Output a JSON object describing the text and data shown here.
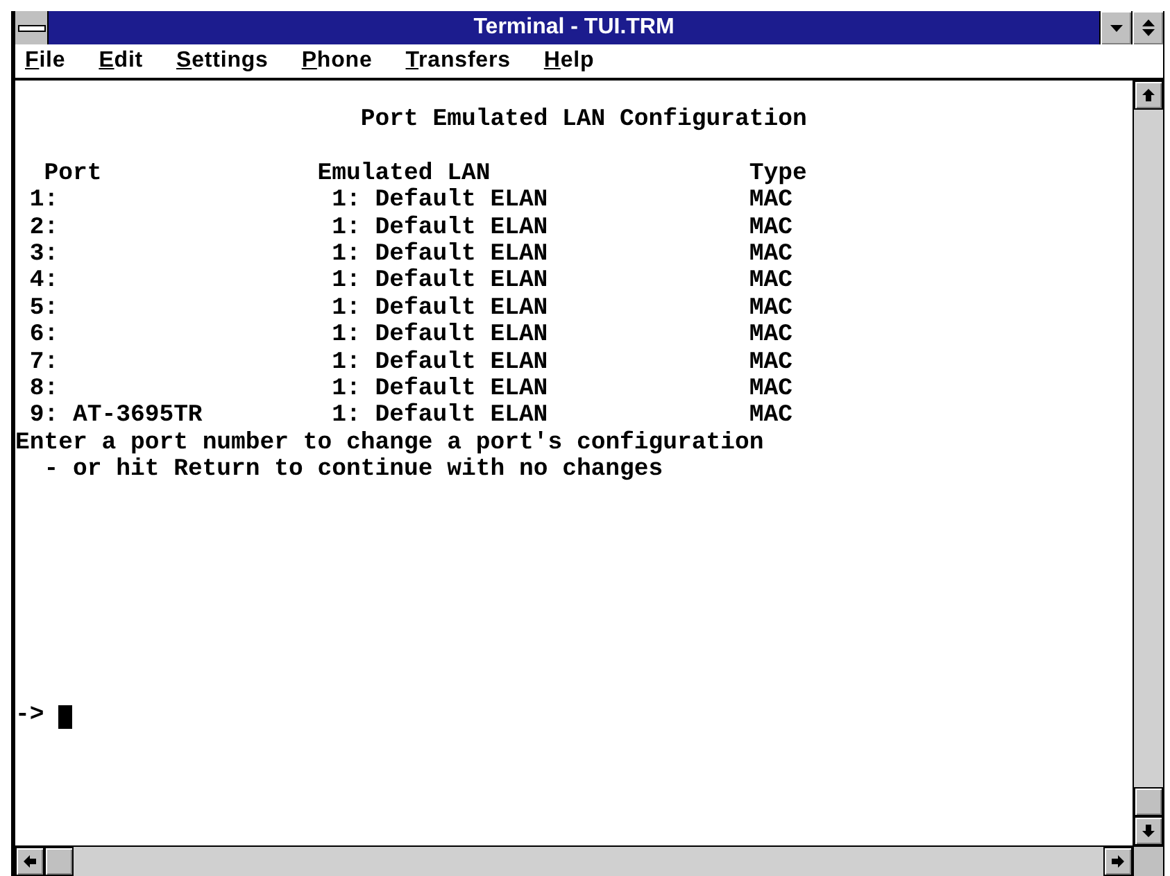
{
  "window": {
    "title": "Terminal - TUI.TRM"
  },
  "menu_bar": [
    "File",
    "Edit",
    "Settings",
    "Phone",
    "Transfers",
    "Help"
  ],
  "terminal": {
    "heading": "Port Emulated LAN Configuration",
    "table": {
      "columns": [
        "Port",
        "Emulated LAN",
        "Type"
      ],
      "rows": [
        {
          "port": "1:",
          "emulated_lan": "1: Default ELAN",
          "type": "MAC"
        },
        {
          "port": "2:",
          "emulated_lan": "1: Default ELAN",
          "type": "MAC"
        },
        {
          "port": "3:",
          "emulated_lan": "1: Default ELAN",
          "type": "MAC"
        },
        {
          "port": "4:",
          "emulated_lan": "1: Default ELAN",
          "type": "MAC"
        },
        {
          "port": "5:",
          "emulated_lan": "1: Default ELAN",
          "type": "MAC"
        },
        {
          "port": "6:",
          "emulated_lan": "1: Default ELAN",
          "type": "MAC"
        },
        {
          "port": "7:",
          "emulated_lan": "1: Default ELAN",
          "type": "MAC"
        },
        {
          "port": "8:",
          "emulated_lan": "1: Default ELAN",
          "type": "MAC"
        },
        {
          "port": "9: AT-3695TR",
          "emulated_lan": "1: Default ELAN",
          "type": "MAC"
        }
      ]
    },
    "instructions": [
      "Enter a port number to change a port's configuration",
      "- or hit Return to continue with no changes"
    ],
    "prompt": "->"
  }
}
